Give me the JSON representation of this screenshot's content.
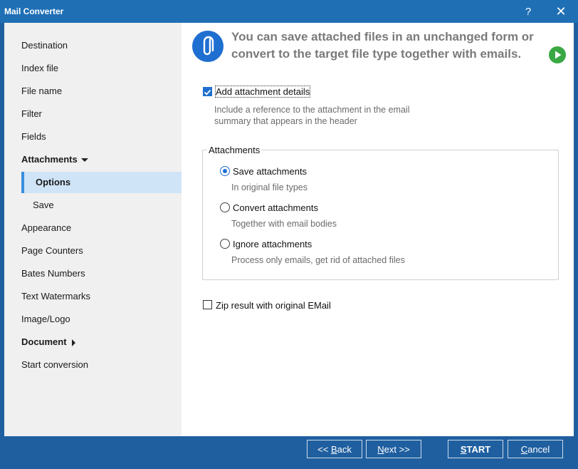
{
  "window": {
    "title": "Mail Converter",
    "help_glyph": "?",
    "close_glyph": "✕"
  },
  "sidebar": {
    "items": [
      {
        "label": "Destination"
      },
      {
        "label": "Index file"
      },
      {
        "label": "File name"
      },
      {
        "label": "Filter"
      },
      {
        "label": "Fields"
      },
      {
        "label": "Attachments",
        "expanded": true
      },
      {
        "label": "Options",
        "selected": true
      },
      {
        "label": "Save"
      },
      {
        "label": "Appearance"
      },
      {
        "label": "Page Counters"
      },
      {
        "label": "Bates Numbers"
      },
      {
        "label": "Text Watermarks"
      },
      {
        "label": "Image/Logo"
      },
      {
        "label": "Document",
        "expanded": false
      },
      {
        "label": "Start conversion"
      }
    ]
  },
  "header": {
    "text": "You can save attached files in an unchanged form or convert to the target file type together with emails.",
    "icon": "paperclip-icon",
    "next_icon": "play-icon"
  },
  "options": {
    "add_details_label": "Add attachment details",
    "add_details_checked": true,
    "add_details_desc_1": "Include a reference to the attachment in the email",
    "add_details_desc_2": "summary that appears in the header",
    "group_title": "Attachments",
    "radios": [
      {
        "label": "Save attachments",
        "desc": "In original file types",
        "selected": true
      },
      {
        "label": "Convert attachments",
        "desc": "Together with email bodies",
        "selected": false
      },
      {
        "label": "Ignore attachments",
        "desc": "Process only emails, get rid of attached files",
        "selected": false
      }
    ],
    "zip_label": "Zip result with original EMail",
    "zip_checked": false
  },
  "footer": {
    "back_prefix": "<< ",
    "back_key": "B",
    "back_rest": "ack",
    "next_key": "N",
    "next_rest": "ext >>",
    "start_key": "S",
    "start_rest": "TART",
    "cancel_key": "C",
    "cancel_rest": "ancel"
  },
  "colors": {
    "accent": "#1f6fd0",
    "titlebar": "#1f6fb5",
    "footer": "#1f5fa0",
    "selected_nav": "#cfe4f7",
    "play_green": "#3aa843"
  }
}
